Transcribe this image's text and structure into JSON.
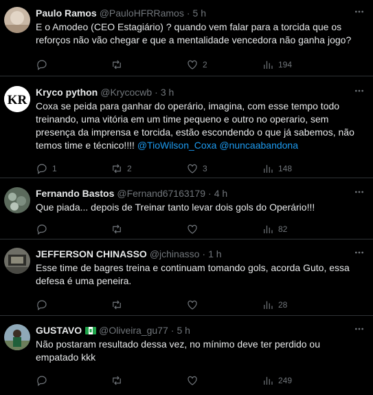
{
  "tweets": [
    {
      "name": "Paulo Ramos",
      "handle": "@PauloHFRRamos",
      "time": "5 h",
      "text": "E o Amodeo (CEO Estagiário) ? quando vem falar para a torcida que os reforços não vão chegar e que a mentalidade vencedora não ganha jogo?",
      "replies": "",
      "retweets": "",
      "likes": "2",
      "views": "194"
    },
    {
      "name": "Kryco python",
      "handle": "@Krycocwb",
      "time": "3 h",
      "text": "Coxa  se peida para ganhar do operário, imagina,  com esse tempo todo treinando, uma vitória em um time pequeno e outro no operario,  sem presença da imprensa e torcida, estão escondendo o que já sabemos,  não temos time e técnico!!!! ",
      "mentions": "@TioWilson_Coxa @nuncaabandona",
      "replies": "1",
      "retweets": "2",
      "likes": "3",
      "views": "148",
      "avatar_text": "KR"
    },
    {
      "name": "Fernando Bastos",
      "handle": "@Fernand67163179",
      "time": "4 h",
      "text": "Que piada... depois de Treinar tanto levar dois gols do Operário!!!",
      "replies": "",
      "retweets": "",
      "likes": "",
      "views": "82"
    },
    {
      "name": "JEFFERSON CHINASSO",
      "handle": "@jchinasso",
      "time": "1 h",
      "text": "Esse time de bagres treina e continuam tomando gols, acorda Guto, essa defesa é uma peneira.",
      "replies": "",
      "retweets": "",
      "likes": "",
      "views": "28"
    },
    {
      "name": "GUSTAVO",
      "handle": "@Oliveira_gu77",
      "time": "5 h",
      "text": "Não postaram resultado dessa vez, no mínimo deve ter perdido ou empatado kkk",
      "replies": "",
      "retweets": "",
      "likes": "",
      "views": "249"
    }
  ],
  "separator": "·",
  "colors": {
    "background": "#000000",
    "text": "#e7e9ea",
    "muted": "#71767b",
    "link": "#1d9bf0",
    "divider": "#2f3336"
  }
}
